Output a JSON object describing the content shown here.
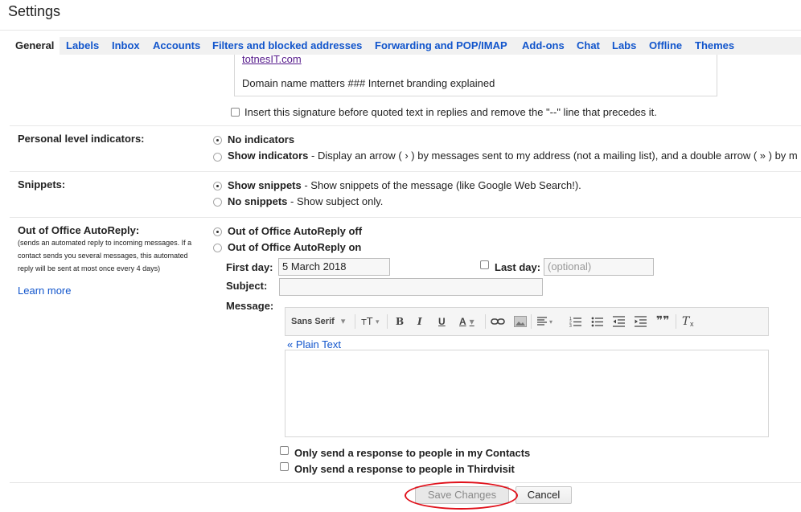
{
  "page": {
    "title": "Settings"
  },
  "tabs": [
    "General",
    "Labels",
    "Inbox",
    "Accounts",
    "Filters and blocked addresses",
    "Forwarding and POP/IMAP",
    "Add-ons",
    "Chat",
    "Labs",
    "Offline",
    "Themes"
  ],
  "signature": {
    "link": "totnesIT.com",
    "line": "Domain name matters ### Internet branding explained",
    "checkbox_label": "Insert this signature before quoted text in replies and remove the \"--\" line that precedes it."
  },
  "personal_indicators": {
    "label": "Personal level indicators:",
    "opt1": "No indicators",
    "opt2": "Show indicators",
    "opt2_desc": " - Display an arrow ( › ) by messages sent to my address (not a mailing list), and a double arrow ( » ) by m",
    "selected": "No indicators"
  },
  "snippets": {
    "label": "Snippets:",
    "opt1": "Show snippets",
    "opt1_desc": " - Show snippets of the message (like Google Web Search!).",
    "opt2": "No snippets",
    "opt2_desc": " - Show subject only.",
    "selected": "Show snippets"
  },
  "auto_reply": {
    "label": "Out of Office AutoReply:",
    "desc": "(sends an automated reply to incoming messages. If a contact sends you several messages, this automated reply will be sent at most once every 4 days)",
    "learn_more": "Learn more",
    "opt_off": "Out of Office AutoReply off",
    "opt_on": "Out of Office AutoReply on",
    "selected": "Out of Office AutoReply off",
    "first_day_label": "First day:",
    "first_day_value": "5 March 2018",
    "last_day_label": "Last day:",
    "last_day_placeholder": "(optional)",
    "subject_label": "Subject:",
    "subject_value": "",
    "message_label": "Message:",
    "plain_text_link": "« Plain Text",
    "contacts_only": "Only send a response to people in my Contacts",
    "domain_only": "Only send a response to people in Thirdvisit"
  },
  "toolbar": {
    "font_select": "Sans Serif",
    "size_icon": "text-size-icon",
    "bold": "B",
    "italic": "I",
    "underline": "U",
    "text_color": "A",
    "link_icon": "link-icon",
    "image_icon": "image-icon",
    "align_icon": "align-icon",
    "numbered_icon": "numbered-list-icon",
    "bulleted_icon": "bulleted-list-icon",
    "indent_less_icon": "indent-less-icon",
    "indent_more_icon": "indent-more-icon",
    "quote_glyph": "❞❞",
    "remove_format_icon": "remove-formatting-icon"
  },
  "buttons": {
    "save": "Save Changes",
    "cancel": "Cancel"
  },
  "colors": {
    "link": "#1155cc",
    "annotation": "#e0101a"
  }
}
